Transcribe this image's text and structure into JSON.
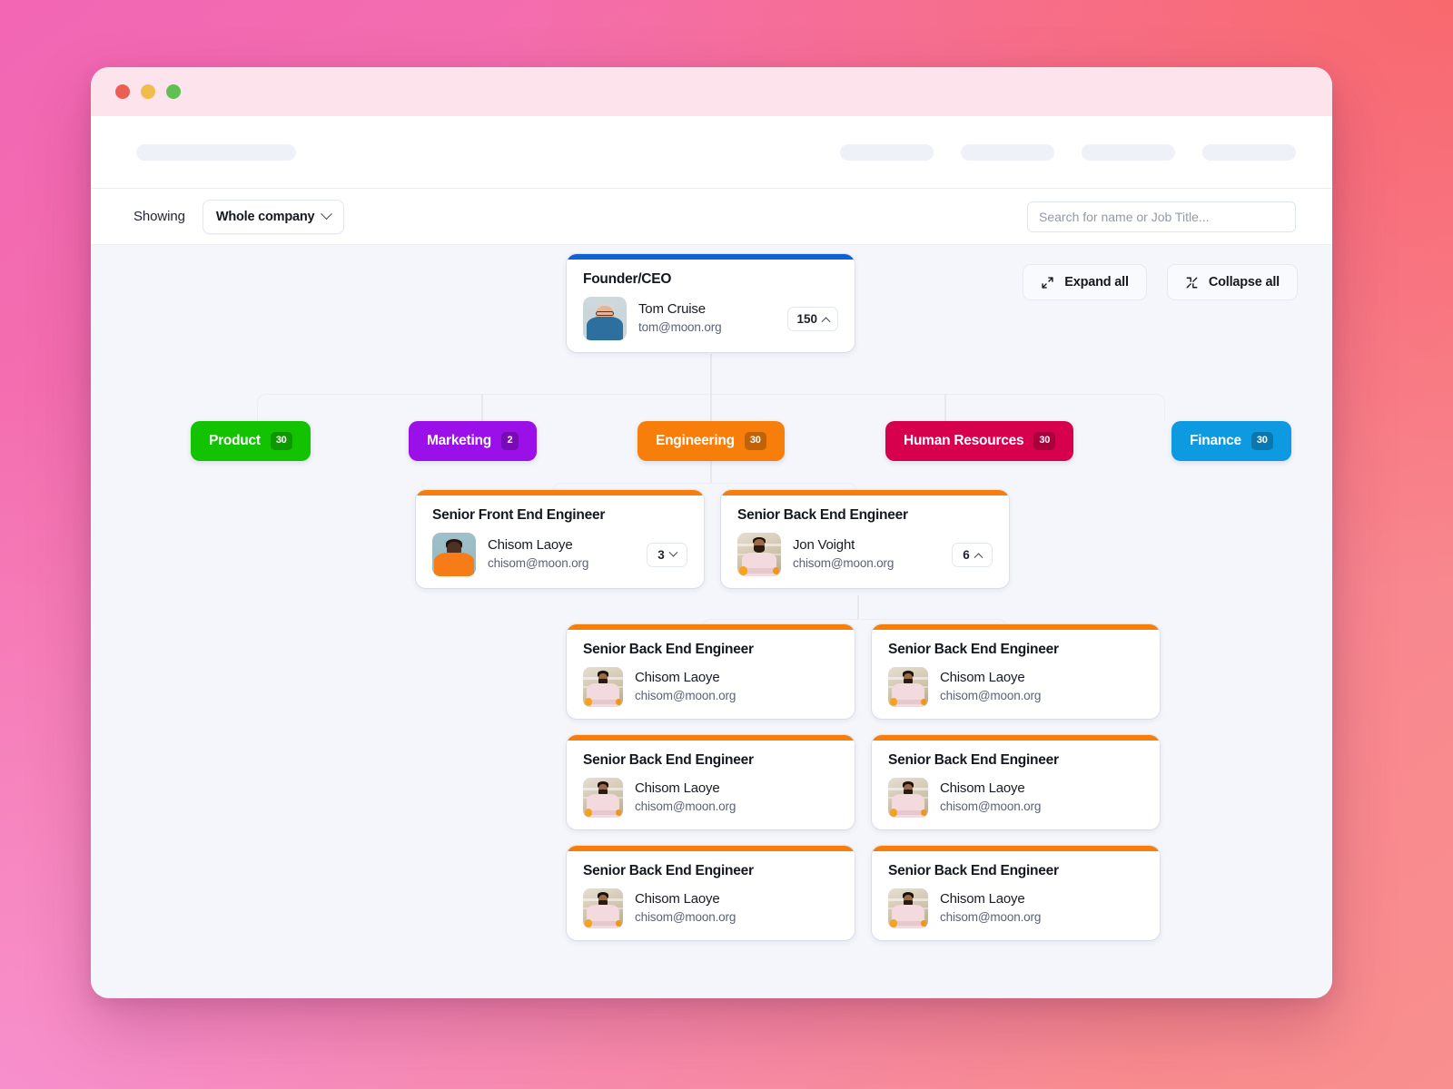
{
  "window": {
    "traffic_lights": [
      "close",
      "minimize",
      "maximize"
    ]
  },
  "filter_bar": {
    "showing_label": "Showing",
    "scope_value": "Whole company",
    "search_placeholder": "Search for name or Job Title..."
  },
  "tree_tools": {
    "expand_all": "Expand all",
    "collapse_all": "Collapse all"
  },
  "ceo": {
    "role": "Founder/CEO",
    "name": "Tom Cruise",
    "email": "tom@moon.org",
    "count": "150",
    "accent": "#0f62d6",
    "expanded": true
  },
  "departments": [
    {
      "label": "Product",
      "count": "30",
      "color": "#13c200"
    },
    {
      "label": "Marketing",
      "count": "2",
      "color": "#9b0fe8"
    },
    {
      "label": "Engineering",
      "count": "30",
      "color": "#f77e0b"
    },
    {
      "label": "Human Resources",
      "count": "30",
      "color": "#d6004c"
    },
    {
      "label": "Finance",
      "count": "30",
      "color": "#0e9ae0"
    }
  ],
  "engineering_children": [
    {
      "role": "Senior Front End Engineer",
      "name": "Chisom Laoye",
      "email": "chisom@moon.org",
      "count": "3",
      "expanded": false,
      "accent": "#f77e0b"
    },
    {
      "role": "Senior Back End Engineer",
      "name": "Jon Voight",
      "email": "chisom@moon.org",
      "count": "6",
      "expanded": true,
      "accent": "#f77e0b"
    }
  ],
  "leaf_nodes": [
    {
      "role": "Senior Back End Engineer",
      "name": "Chisom Laoye",
      "email": "chisom@moon.org",
      "accent": "#f77e0b"
    },
    {
      "role": "Senior Back End Engineer",
      "name": "Chisom Laoye",
      "email": "chisom@moon.org",
      "accent": "#f77e0b"
    },
    {
      "role": "Senior Back End Engineer",
      "name": "Chisom Laoye",
      "email": "chisom@moon.org",
      "accent": "#f77e0b"
    },
    {
      "role": "Senior Back End Engineer",
      "name": "Chisom Laoye",
      "email": "chisom@moon.org",
      "accent": "#f77e0b"
    },
    {
      "role": "Senior Back End Engineer",
      "name": "Chisom Laoye",
      "email": "chisom@moon.org",
      "accent": "#f77e0b"
    },
    {
      "role": "Senior Back End Engineer",
      "name": "Chisom Laoye",
      "email": "chisom@moon.org",
      "accent": "#f77e0b"
    }
  ]
}
